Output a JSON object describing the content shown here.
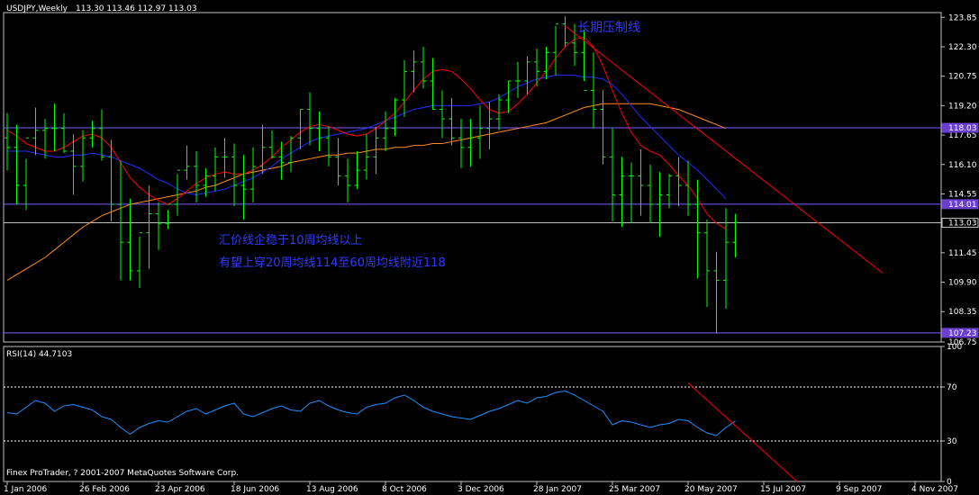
{
  "colors": {
    "background": "#000000",
    "frame": "#c0c0c0",
    "grid_text": "#ffffff",
    "bars": "#00ff00",
    "ma10": "#ff0000",
    "ma20": "#1f2dff",
    "ma60": "#ff8c1a",
    "hlines": "#7b5bff",
    "price_line": "#c0c0c0",
    "trendline": "#ff0000",
    "annotation": "#2f3aff",
    "rsi": "#1e90ff",
    "tag_purple": "#6a3fd0"
  },
  "header": {
    "symbol": "USDJPY,Weekly",
    "ohlc": "113.30 113.46 112.97 113.03"
  },
  "rsi_header": {
    "label": "RSI(14) 44.7103"
  },
  "copyright": "Finex ProTrader, ? 2001-2007 MetaQuotes Software Corp.",
  "annotations": {
    "resistance": "长期压制线",
    "line1": "汇价线企稳于10周均线以上",
    "line2": "有望上穿20周均线114至60周均线附近118"
  },
  "chart_data": [
    {
      "type": "ohlc",
      "title": "USDJPY,Weekly",
      "ylim": [
        106.75,
        124.1
      ],
      "y_ticks": [
        "123.85",
        "122.30",
        "120.75",
        "119.20",
        "117.65",
        "116.10",
        "114.55",
        "113.00",
        "111.45",
        "109.90",
        "108.35",
        "106.75"
      ],
      "x_tick_labels": [
        "1 Jan 2006",
        "26 Feb 2006",
        "23 Apr 2006",
        "18 Jun 2006",
        "13 Aug 2006",
        "8 Oct 2006",
        "3 Dec 2006",
        "28 Jan 2007",
        "25 Mar 2007",
        "20 May 2007",
        "15 Jul 2007",
        "9 Sep 2007",
        "4 Nov 2007"
      ],
      "tagged_levels": [
        {
          "label": "118.03",
          "value": 118.03
        },
        {
          "label": "114.01",
          "value": 114.01
        },
        {
          "label": "113.03",
          "value": 113.03
        },
        {
          "label": "107.23",
          "value": 107.23
        }
      ],
      "series": [
        {
          "name": "10周均线",
          "values": [
            117.9,
            117.6,
            117.2,
            117.0,
            116.8,
            116.8,
            117.0,
            117.3,
            117.6,
            117.7,
            117.5,
            117.0,
            116.2,
            115.4,
            114.9,
            114.5,
            114.2,
            114.0,
            114.3,
            114.7,
            115.1,
            115.4,
            115.6,
            115.7,
            115.6,
            115.6,
            115.8,
            116.1,
            116.5,
            117.0,
            117.4,
            117.8,
            118.1,
            118.2,
            118.1,
            117.9,
            117.7,
            117.6,
            117.7,
            118.0,
            118.4,
            118.8,
            119.4,
            120.0,
            120.6,
            121.0,
            121.1,
            121.0,
            120.6,
            120.1,
            119.5,
            119.0,
            118.8,
            118.9,
            119.3,
            119.8,
            120.4,
            121.0,
            121.7,
            122.3,
            122.7,
            122.8,
            122.3,
            121.3,
            120.0,
            118.8,
            117.8,
            117.1,
            116.8,
            116.6,
            116.1,
            115.5,
            115.0,
            114.3,
            113.5,
            113.0,
            112.7
          ]
        },
        {
          "name": "20周均线",
          "values": [
            116.8,
            116.8,
            116.8,
            116.7,
            116.6,
            116.5,
            116.5,
            116.6,
            116.6,
            116.7,
            116.6,
            116.5,
            116.3,
            116.1,
            115.9,
            115.6,
            115.3,
            115.1,
            114.8,
            114.6,
            114.5,
            114.6,
            114.7,
            114.8,
            115.0,
            115.2,
            115.4,
            115.7,
            116.0,
            116.4,
            116.7,
            117.0,
            117.3,
            117.5,
            117.6,
            117.7,
            117.8,
            117.9,
            118.0,
            118.2,
            118.4,
            118.6,
            118.8,
            119.0,
            119.1,
            119.2,
            119.2,
            119.2,
            119.2,
            119.2,
            119.3,
            119.4,
            119.6,
            119.9,
            120.2,
            120.4,
            120.6,
            120.7,
            120.8,
            120.8,
            120.8,
            120.7,
            120.7,
            120.6,
            120.3,
            119.8,
            119.2,
            118.6,
            118.1,
            117.6,
            117.1,
            116.6,
            116.2,
            115.8,
            115.3,
            114.8,
            114.3
          ]
        },
        {
          "name": "60周均线",
          "values": [
            110.0,
            110.3,
            110.6,
            110.9,
            111.2,
            111.6,
            112.0,
            112.4,
            112.8,
            113.1,
            113.4,
            113.6,
            113.8,
            114.0,
            114.1,
            114.2,
            114.3,
            114.4,
            114.5,
            114.6,
            114.7,
            114.9,
            115.0,
            115.2,
            115.4,
            115.6,
            115.7,
            115.8,
            115.9,
            116.0,
            116.2,
            116.3,
            116.4,
            116.5,
            116.6,
            116.6,
            116.7,
            116.7,
            116.8,
            116.9,
            116.9,
            117.0,
            117.0,
            117.1,
            117.1,
            117.2,
            117.2,
            117.3,
            117.4,
            117.5,
            117.6,
            117.7,
            117.8,
            117.9,
            118.0,
            118.1,
            118.2,
            118.3,
            118.5,
            118.7,
            118.9,
            119.1,
            119.2,
            119.3,
            119.3,
            119.3,
            119.3,
            119.3,
            119.3,
            119.2,
            119.1,
            119.0,
            118.8,
            118.6,
            118.4,
            118.2,
            118.0
          ]
        },
        {
          "name": "bars",
          "high": [
            118.8,
            118.2,
            116.4,
            119.1,
            118.5,
            119.3,
            118.8,
            117.7,
            117.9,
            118.4,
            119.0,
            117.4,
            116.3,
            114.3,
            112.3,
            115.0,
            114.1,
            113.7,
            115.6,
            117.1,
            116.8,
            115.9,
            117.0,
            117.5,
            117.2,
            116.6,
            117.0,
            118.2,
            117.9,
            117.3,
            117.6,
            119.0,
            119.9,
            118.9,
            118.1,
            117.5,
            116.4,
            116.8,
            117.7,
            118.1,
            118.9,
            119.6,
            121.6,
            122.1,
            122.3,
            121.7,
            120.0,
            119.6,
            118.5,
            118.5,
            119.2,
            119.4,
            119.8,
            120.5,
            121.5,
            121.8,
            122.2,
            122.3,
            123.4,
            123.9,
            123.5,
            123.2,
            122.0,
            120.0,
            118.0,
            116.5,
            116.2,
            116.9,
            116.1,
            115.7,
            115.6,
            116.5,
            116.3,
            115.3,
            113.2,
            111.5,
            113.8,
            113.5
          ],
          "low": [
            115.8,
            114.0,
            113.7,
            116.6,
            116.4,
            116.8,
            116.7,
            114.5,
            115.2,
            117.0,
            116.3,
            113.1,
            110.0,
            110.0,
            109.6,
            110.6,
            111.6,
            112.7,
            113.4,
            115.3,
            114.1,
            114.4,
            114.7,
            115.4,
            113.9,
            113.2,
            114.1,
            115.6,
            116.4,
            115.3,
            115.7,
            116.9,
            117.1,
            116.8,
            116.0,
            115.0,
            114.1,
            114.8,
            115.3,
            115.6,
            116.8,
            117.6,
            118.6,
            119.9,
            120.1,
            119.0,
            117.5,
            117.1,
            115.9,
            116.0,
            116.4,
            116.9,
            117.9,
            118.8,
            119.6,
            119.8,
            120.2,
            120.6,
            120.8,
            122.3,
            121.3,
            120.5,
            118.0,
            116.1,
            113.1,
            112.8,
            113.0,
            113.4,
            113.0,
            112.3,
            113.8,
            113.9,
            113.4,
            110.1,
            108.6,
            107.2,
            108.5,
            111.2
          ],
          "open": [
            117.5,
            117.0,
            115.0,
            117.5,
            117.9,
            118.0,
            118.0,
            116.8,
            116.0,
            117.5,
            118.0,
            116.5,
            114.0,
            112.0,
            110.5,
            112.5,
            113.5,
            113.0,
            114.0,
            115.8,
            116.0,
            115.0,
            115.5,
            116.5,
            116.5,
            115.0,
            114.8,
            116.0,
            117.0,
            116.5,
            116.2,
            117.5,
            119.0,
            118.0,
            117.5,
            116.5,
            115.5,
            115.0,
            115.8,
            116.5,
            117.5,
            118.0,
            119.5,
            121.0,
            121.5,
            120.5,
            119.0,
            118.5,
            117.5,
            117.0,
            117.5,
            118.0,
            118.5,
            119.5,
            120.5,
            120.5,
            121.5,
            121.0,
            122.0,
            123.5,
            122.5,
            122.0,
            120.0,
            119.0,
            116.5,
            114.5,
            115.5,
            115.5,
            115.0,
            114.0,
            114.5,
            115.5,
            115.0,
            114.0,
            112.5,
            110.5,
            110.0,
            112.0
          ],
          "close": [
            117.0,
            115.0,
            117.5,
            117.9,
            118.0,
            118.0,
            116.8,
            116.0,
            117.5,
            118.0,
            116.5,
            114.0,
            112.0,
            110.5,
            112.5,
            113.5,
            113.0,
            114.0,
            115.8,
            116.0,
            115.0,
            115.5,
            116.5,
            116.5,
            115.0,
            114.8,
            116.0,
            117.0,
            116.5,
            116.2,
            117.5,
            119.0,
            118.0,
            117.5,
            116.5,
            115.5,
            115.0,
            115.8,
            116.5,
            117.5,
            118.0,
            119.5,
            121.0,
            121.5,
            120.5,
            119.0,
            118.5,
            117.5,
            117.0,
            117.5,
            118.0,
            118.5,
            119.5,
            120.5,
            120.5,
            121.5,
            121.0,
            122.0,
            123.5,
            122.5,
            122.0,
            120.0,
            119.0,
            116.5,
            114.5,
            115.5,
            115.5,
            115.0,
            114.0,
            114.5,
            115.5,
            115.0,
            114.0,
            112.5,
            110.5,
            110.0,
            112.0,
            113.03
          ]
        }
      ]
    },
    {
      "type": "line",
      "title": "RSI(14) 44.7103",
      "ylim": [
        0,
        100
      ],
      "y_ticks": [
        "100",
        "70",
        "30",
        "0"
      ],
      "dotted_levels": [
        70,
        30
      ],
      "series": [
        {
          "name": "RSI",
          "values": [
            51,
            50,
            55,
            60,
            58,
            52,
            56,
            57,
            55,
            53,
            48,
            46,
            40,
            35,
            40,
            43,
            45,
            44,
            48,
            52,
            54,
            50,
            53,
            56,
            58,
            50,
            48,
            51,
            54,
            56,
            53,
            52,
            58,
            60,
            56,
            53,
            51,
            50,
            55,
            57,
            58,
            62,
            64,
            60,
            55,
            52,
            50,
            48,
            47,
            46,
            49,
            52,
            54,
            57,
            60,
            58,
            62,
            63,
            66,
            67,
            64,
            60,
            56,
            52,
            42,
            45,
            44,
            42,
            40,
            42,
            43,
            46,
            45,
            40,
            36,
            34,
            40,
            44.71
          ]
        }
      ]
    }
  ]
}
